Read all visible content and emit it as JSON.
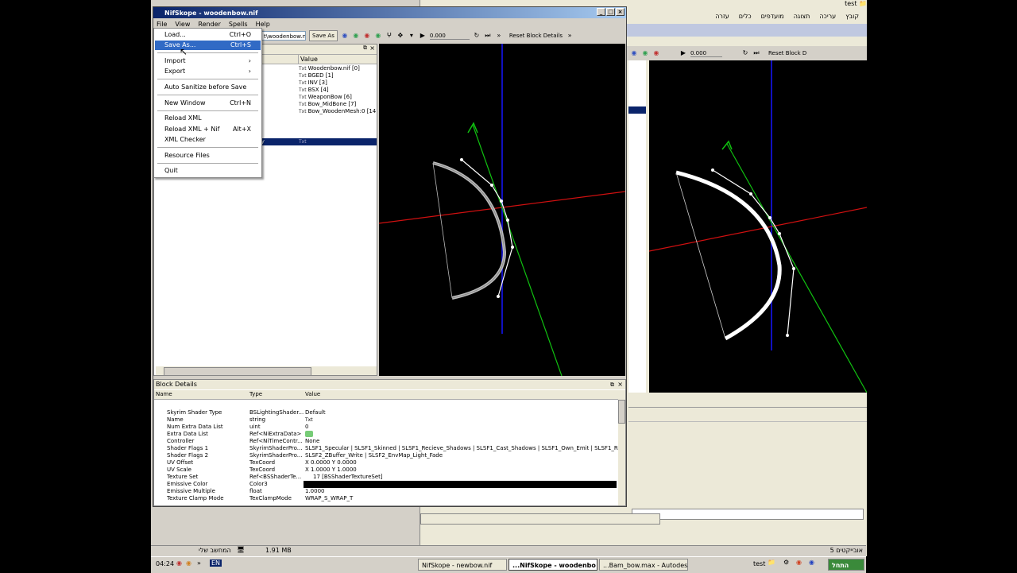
{
  "main_window": {
    "title": "NifSkope - woodenbow.nif",
    "menu": [
      "File",
      "View",
      "Render",
      "Spells",
      "Help"
    ],
    "toolbar": {
      "file_path": "t\\woodenbow.nif",
      "save_as_label": "Save As",
      "time_value": "0.000",
      "reset_label": "Reset Block Details"
    }
  },
  "file_menu": {
    "items": [
      {
        "label": "Load...",
        "shortcut": "Ctrl+O"
      },
      {
        "label": "Save As...",
        "shortcut": "Ctrl+S",
        "highlighted": true
      },
      {
        "label": "Import",
        "submenu": true
      },
      {
        "label": "Export",
        "submenu": true
      },
      {
        "label": "Auto Sanitize before Save"
      },
      {
        "label": "New Window",
        "shortcut": "Ctrl+N"
      },
      {
        "label": "Reload XML"
      },
      {
        "label": "Reload XML + Nif",
        "shortcut": "Alt+X"
      },
      {
        "label": "XML Checker"
      },
      {
        "label": "Resource Files"
      },
      {
        "label": "Quit"
      }
    ]
  },
  "block_list": {
    "value_header": "Value",
    "type_badge": "Txt",
    "rows": [
      "Woodenbow.nif [0]",
      "BGED [1]",
      "INV [3]",
      "BSX [4]",
      "WeaponBow [6]",
      "Bow_MidBone [7]",
      "Bow_WoodenMesh:0 [14"
    ],
    "selected_suffix": "ty"
  },
  "block_details": {
    "title": "Block Details",
    "headers": {
      "name": "Name",
      "type": "Type",
      "value": "Value"
    },
    "rows": [
      {
        "name": "Skyrim Shader Type",
        "type": "BSLightingShader...",
        "value": "Default"
      },
      {
        "name": "Name",
        "type": "string",
        "value": "Txt"
      },
      {
        "name": "Num Extra Data List",
        "type": "uint",
        "value": "0"
      },
      {
        "name": "Extra Data List",
        "type": "Ref<NiExtraData>",
        "value": ""
      },
      {
        "name": "Controller",
        "type": "Ref<NiTimeContr...",
        "value": "None"
      },
      {
        "name": "Shader Flags 1",
        "type": "SkyrimShaderPro...",
        "value": "SLSF1_Specular | SLSF1_Skinned | SLSF1_Recieve_Shadows | SLSF1_Cast_Shadows | SLSF1_Own_Emit | SLSF1_Re"
      },
      {
        "name": "Shader Flags 2",
        "type": "SkyrimShaderPro...",
        "value": "SLSF2_ZBuffer_Write | SLSF2_EnvMap_Light_Fade"
      },
      {
        "name": "UV Offset",
        "type": "TexCoord",
        "value": "X 0.0000 Y 0.0000"
      },
      {
        "name": "UV Scale",
        "type": "TexCoord",
        "value": "X 1.0000 Y 1.0000"
      },
      {
        "name": "Texture Set",
        "type": "Ref<BSShaderTe...",
        "value": "17 [BSShaderTextureSet]"
      },
      {
        "name": "Emissive Color",
        "type": "Color3",
        "value": ""
      },
      {
        "name": "Emissive Multiple",
        "type": "float",
        "value": "1.0000"
      },
      {
        "name": "Texture Clamp Mode",
        "type": "TexClampMode",
        "value": "WRAP_S_WRAP_T"
      }
    ]
  },
  "background_app": {
    "title": "test",
    "menu": [
      "קובץ",
      "עריכה",
      "תצוגה",
      "מועדפים",
      "כלים",
      "עזרה"
    ],
    "time_value": "0.000",
    "reset_label": "Reset Block D",
    "status_left": "המחשב שלי",
    "status_size": "1.91 MB",
    "status_right": "5 אובייקטים"
  },
  "taskbar": {
    "clock": "04:24",
    "language": "EN",
    "tasks": [
      "NifSkope - newbow.nif",
      "...NifSkope - woodenbo",
      "...Bam_bow.max - Autodes"
    ],
    "tray_label": "test",
    "start_label": "התחל"
  },
  "colors": {
    "title_bar": "#0a246a",
    "menu_highlight": "#316ac5",
    "axis_x": "#d01010",
    "axis_y": "#10c010",
    "axis_z": "#1010c0"
  }
}
